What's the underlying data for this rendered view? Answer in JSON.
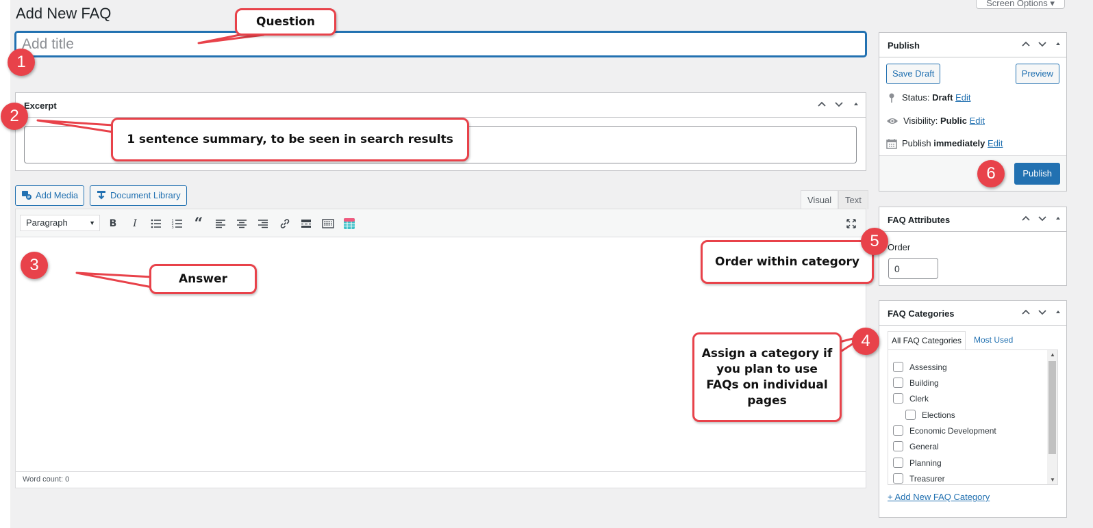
{
  "page": {
    "title": "Add New FAQ",
    "screen_options": "Screen Options ▾"
  },
  "title_field": {
    "placeholder": "Add title"
  },
  "excerpt": {
    "heading": "Excerpt"
  },
  "media_buttons": {
    "add_media": "Add Media",
    "document_library": "Document Library"
  },
  "editor": {
    "tabs": [
      "Visual",
      "Text"
    ],
    "format_select": "Paragraph",
    "word_count": "Word count: 0"
  },
  "publish": {
    "heading": "Publish",
    "save_draft": "Save Draft",
    "preview": "Preview",
    "status_label": "Status: ",
    "status_value": "Draft",
    "visibility_label": "Visibility: ",
    "visibility_value": "Public",
    "publish_label": "Publish ",
    "publish_value": "immediately",
    "edit": "Edit",
    "publish_button": "Publish"
  },
  "attributes": {
    "heading": "FAQ Attributes",
    "order_label": "Order",
    "order_value": "0"
  },
  "categories": {
    "heading": "FAQ Categories",
    "tab_all": "All FAQ Categories",
    "tab_used": "Most Used",
    "items": [
      "Assessing",
      "Building",
      "Clerk",
      "Elections",
      "Economic Development",
      "General",
      "Planning",
      "Treasurer"
    ],
    "add_new": "+ Add New FAQ Category"
  },
  "annotations": {
    "question": "Question",
    "summary": "1 sentence summary, to be seen in search results",
    "answer": "Answer",
    "order": "Order within category",
    "category": "Assign a category if you plan to use FAQs on individual pages",
    "badges": [
      "1",
      "2",
      "3",
      "4",
      "5",
      "6"
    ]
  },
  "colors": {
    "accent": "#2271b1",
    "annotation": "#e8424a",
    "background": "#f0f0f1"
  }
}
